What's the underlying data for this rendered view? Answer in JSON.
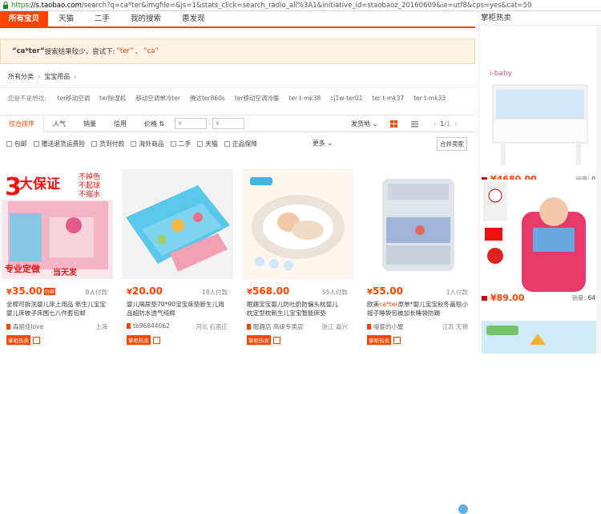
{
  "browser": {
    "url_scheme": "https",
    "url_host": "://s.taobao.com",
    "url_rest": "/search?q=ca*ter&imgfile=&js=1&stats_click=search_radio_all%3A1&initiative_id=staobaoz_20160609&ie=utf8&cps=yes&cat=50"
  },
  "tabs": [
    "所有宝贝",
    "天猫",
    "二手",
    "我的搜索",
    "惠发现"
  ],
  "notice": {
    "query": "“ca*ter”",
    "text": "搜索结果较少，尝试下:",
    "suggest1": "“ter”",
    "sep": "、",
    "suggest2": "“ca”"
  },
  "breadcrumb": {
    "root": "所有分类",
    "sep": "›",
    "current": "宝宝用品",
    "arrow": "›"
  },
  "guess": {
    "label": "您是不是想找:",
    "items": [
      "ter移动空调",
      "ter除湿机",
      "移动空调单冷ter",
      "腾达ter860s",
      "ter移动空调冷暖",
      "ter t-mk38",
      "cj1w-ter01",
      "ter t-mk37",
      "ter t-mk33"
    ]
  },
  "sort": {
    "items": [
      "综合排序",
      "人气",
      "销量",
      "信用",
      "价格"
    ],
    "price_caret": "⇅",
    "min_placeholder": "¥",
    "dash": "-",
    "max_placeholder": "¥",
    "ship": "发货地",
    "ship_caret": "⌄",
    "page_prev": "‹",
    "page_current": "1",
    "page_total": "/1",
    "page_next": "›"
  },
  "filters": {
    "items": [
      "包邮",
      "赠送退货运费险",
      "货到付款",
      "海外商品",
      "二手",
      "天猫",
      "正品保障"
    ],
    "more": "更多",
    "more_caret": "⌄",
    "merge": "合并卖家"
  },
  "products": [
    {
      "price": "35.00",
      "yen": "¥",
      "tag": "包邮",
      "sales": "8人付款",
      "title_parts": [
        "全棉可拆洗婴儿床上用品 新生儿宝宝",
        "婴儿床被子床围七八件套包邮"
      ],
      "title_hl": "",
      "shop": "森丽佳love",
      "loc": "上海",
      "badge": "掌柜热卖"
    },
    {
      "price": "20.00",
      "yen": "¥",
      "tag": "",
      "sales": "18人付款",
      "title_parts": [
        "婴儿隔尿垫70*90宝宝床垫新生儿用",
        "品超防水透气纯棉"
      ],
      "title_hl": "",
      "shop": "tb96844062",
      "loc": "河北 石家庄",
      "badge": "掌柜热卖"
    },
    {
      "price": "568.00",
      "yen": "¥",
      "tag": "",
      "sales": "55人付款",
      "title_parts": [
        "眠趣宝宝婴儿防吐奶防偏头枕婴儿",
        "枕定型枕新生儿宝宝智能床垫"
      ],
      "title_hl": "",
      "shop": "眠趣店 高级专卖店",
      "loc": "浙江 嘉兴",
      "badge": "掌柜热卖"
    },
    {
      "price": "55.00",
      "yen": "¥",
      "tag": "",
      "sales": "1人付款",
      "title_parts": [
        "欧美",
        "原单*婴儿宝宝秋冬盖毯小",
        "摇子睡袋包被加长睡袋防踢"
      ],
      "title_hl": "ca*ter",
      "shop": "嗳婴的小屋",
      "loc": "江苏 无锡",
      "badge": "掌柜热卖"
    }
  ],
  "right_panel": {
    "header": "掌柜热卖",
    "items": [
      {
        "price": "¥4680.00",
        "sales_label": "销量:",
        "sales": "0"
      },
      {
        "price": "¥89.00",
        "sales_label": "销量:",
        "sales": "64"
      }
    ]
  },
  "colors": {
    "accent": "#ff4400"
  }
}
